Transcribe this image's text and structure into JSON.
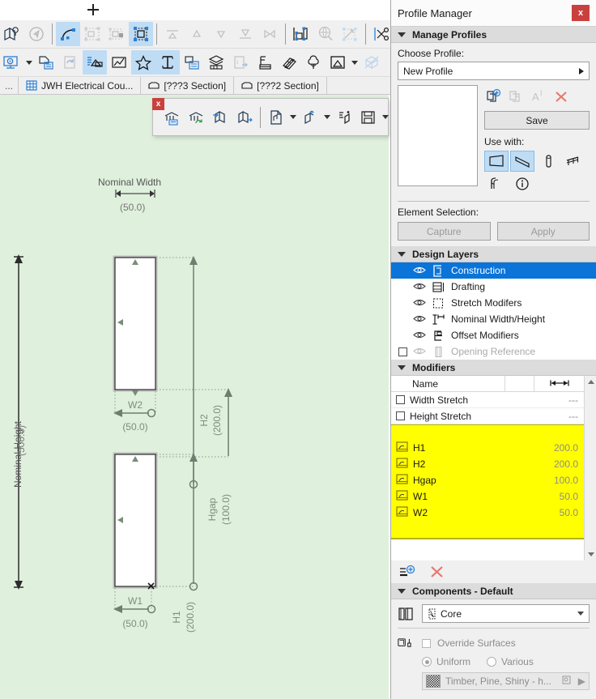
{
  "window": {
    "panel_title": "Profile Manager",
    "close_label": "x"
  },
  "toolbar_rows": [
    {
      "name": "toolbar-row-1",
      "buttons": [
        {
          "icon": "map-location-icon",
          "selected": false,
          "disabled": false
        },
        {
          "icon": "compass-icon",
          "selected": false,
          "disabled": true
        },
        {
          "sep": true
        },
        {
          "icon": "polyline-edit-icon",
          "selected": true,
          "disabled": false
        },
        {
          "icon": "group-selection-icon",
          "selected": false,
          "disabled": true
        },
        {
          "icon": "ungroup-selection-icon",
          "selected": false,
          "disabled": true
        },
        {
          "icon": "edit-group-icon",
          "selected": true,
          "disabled": false
        },
        {
          "sep": true
        },
        {
          "icon": "align-top-icon",
          "selected": false,
          "disabled": true
        },
        {
          "icon": "align-up-icon",
          "selected": false,
          "disabled": true
        },
        {
          "icon": "align-down-icon",
          "selected": false,
          "disabled": true
        },
        {
          "icon": "align-bottom-icon",
          "selected": false,
          "disabled": true
        },
        {
          "icon": "align-horizontal-icon",
          "selected": false,
          "disabled": true
        },
        {
          "sep": true
        },
        {
          "icon": "dimension-tool-icon",
          "selected": false,
          "disabled": false
        },
        {
          "icon": "globe-search-icon",
          "selected": false,
          "disabled": true
        },
        {
          "icon": "stretch-modifier-icon",
          "selected": false,
          "disabled": true
        },
        {
          "sep": true
        },
        {
          "icon": "scissors-icon",
          "selected": false,
          "disabled": false
        }
      ]
    },
    {
      "name": "toolbar-row-2",
      "buttons": [
        {
          "icon": "settings-monitor-icon",
          "selected": false,
          "disabled": false
        },
        {
          "caret": true
        },
        {
          "icon": "copy-page-icon",
          "selected": false,
          "disabled": false
        },
        {
          "icon": "refresh-page-icon",
          "selected": false,
          "disabled": true
        },
        {
          "icon": "building-list-icon",
          "selected": true,
          "disabled": false
        },
        {
          "icon": "chart-edit-icon",
          "selected": false,
          "disabled": false
        },
        {
          "icon": "star-icon",
          "selected": true,
          "disabled": false
        },
        {
          "icon": "beam-profile-icon",
          "selected": true,
          "disabled": false
        },
        {
          "icon": "duplicate-doc-icon",
          "selected": false,
          "disabled": false
        },
        {
          "icon": "layers-stack-icon",
          "selected": false,
          "disabled": false
        },
        {
          "icon": "publish-icon",
          "selected": false,
          "disabled": true
        },
        {
          "icon": "label-list-icon",
          "selected": false,
          "disabled": false
        },
        {
          "icon": "tags-icon",
          "selected": false,
          "disabled": false
        },
        {
          "icon": "tree-icon",
          "selected": false,
          "disabled": false
        },
        {
          "icon": "elevation-house-icon",
          "selected": false,
          "disabled": false
        },
        {
          "caret": true
        },
        {
          "icon": "cut-3d-icon",
          "selected": false,
          "disabled": true
        }
      ]
    }
  ],
  "tabs": [
    {
      "label": "...",
      "icon": "none"
    },
    {
      "label": "JWH Electrical Cou...",
      "icon": "grid-icon"
    },
    {
      "label": "[???3 Section]",
      "icon": "section-icon"
    },
    {
      "label": "[???2 Section]",
      "icon": "section-icon"
    }
  ],
  "mini_toolbar": {
    "close_label": "x",
    "buttons": [
      {
        "icon": "library-info-icon"
      },
      {
        "icon": "library-refresh-icon"
      },
      {
        "icon": "import-object-icon"
      },
      {
        "icon": "export-object-icon"
      },
      {
        "sep": true
      },
      {
        "icon": "new-object-icon"
      },
      {
        "caret": true
      },
      {
        "icon": "place-object-icon"
      },
      {
        "caret": true
      },
      {
        "icon": "object-settings-icon"
      },
      {
        "icon": "save-object-icon"
      },
      {
        "caret": true
      },
      {
        "icon": "dim-icon",
        "disabled": true
      }
    ]
  },
  "canvas": {
    "nominal_width_label": "Nominal Width",
    "nominal_width_value": "(50.0)",
    "nominal_height_label": "Nominal Height",
    "nominal_height_value": "(500.0)",
    "dims": [
      {
        "name": "H2",
        "value": "(200.0)"
      },
      {
        "name": "W2",
        "value": "(50.0)"
      },
      {
        "name": "Hgap",
        "value": "(100.0)"
      },
      {
        "name": "H1",
        "value": "(200.0)"
      },
      {
        "name": "W1",
        "value": "(50.0)"
      }
    ]
  },
  "profile_manager": {
    "manage_profiles_header": "Manage Profiles",
    "choose_profile_label": "Choose Profile:",
    "selected_profile": "New Profile",
    "actions": [
      {
        "icon": "new-profile-icon",
        "disabled": false
      },
      {
        "icon": "duplicate-profile-icon",
        "disabled": true
      },
      {
        "icon": "rename-profile-icon",
        "disabled": true
      },
      {
        "icon": "delete-profile-icon",
        "disabled": false
      }
    ],
    "save_label": "Save",
    "use_with_label": "Use with:",
    "use_with": [
      {
        "icon": "wall-icon",
        "selected": true
      },
      {
        "icon": "beam-icon",
        "selected": true
      },
      {
        "icon": "column-icon",
        "selected": false
      },
      {
        "icon": "railing-icon",
        "selected": false
      },
      {
        "icon": "handrail-icon",
        "selected": false
      },
      {
        "icon": "info-icon",
        "selected": false
      }
    ],
    "element_selection_label": "Element Selection:",
    "capture_label": "Capture",
    "apply_label": "Apply",
    "design_layers_header": "Design Layers",
    "design_layers": [
      {
        "label": "Construction",
        "icon": "construction-layer-icon",
        "active": true,
        "disabled": false,
        "checkbox": false
      },
      {
        "label": "Drafting",
        "icon": "drafting-layer-icon",
        "active": false,
        "disabled": false,
        "checkbox": false
      },
      {
        "label": "Stretch Modifers",
        "icon": "stretch-layer-icon",
        "active": false,
        "disabled": false,
        "checkbox": false
      },
      {
        "label": "Nominal Width/Height",
        "icon": "nominal-layer-icon",
        "active": false,
        "disabled": false,
        "checkbox": false
      },
      {
        "label": "Offset Modifiers",
        "icon": "offset-layer-icon",
        "active": false,
        "disabled": false,
        "checkbox": false
      },
      {
        "label": "Opening Reference",
        "icon": "opening-layer-icon",
        "active": false,
        "disabled": true,
        "checkbox": true
      }
    ],
    "modifiers_header": "Modifiers",
    "modifiers_columns": [
      "Name",
      "",
      "width-dim-icon"
    ],
    "modifiers_plain": [
      {
        "label": "Width Stretch",
        "value": "---",
        "checkbox": true
      },
      {
        "label": "Height Stretch",
        "value": "---",
        "checkbox": true
      }
    ],
    "modifiers_highlighted": [
      {
        "label": "H1",
        "value": "200.0",
        "icon": "modifier-icon"
      },
      {
        "label": "H2",
        "value": "200.0",
        "icon": "modifier-icon"
      },
      {
        "label": "Hgap",
        "value": "100.0",
        "icon": "modifier-icon"
      },
      {
        "label": "W1",
        "value": "50.0",
        "icon": "modifier-icon"
      },
      {
        "label": "W2",
        "value": "50.0",
        "icon": "modifier-icon"
      }
    ],
    "modifier_tools": [
      {
        "icon": "add-modifier-icon"
      },
      {
        "icon": "delete-modifier-icon"
      }
    ],
    "components_header": "Components - Default",
    "component_selected": "Core",
    "override_surfaces_label": "Override Surfaces",
    "uniform_label": "Uniform",
    "various_label": "Various",
    "material_name": "Timber, Pine, Shiny - h..."
  },
  "colors": {
    "accent_blue": "#0a74d8",
    "selection_blue": "#bfdcf5",
    "highlight_yellow": "#ffff00",
    "close_red": "#c9413f",
    "canvas_green": "#dff0dd",
    "dim_gray": "#7a8a7a"
  }
}
